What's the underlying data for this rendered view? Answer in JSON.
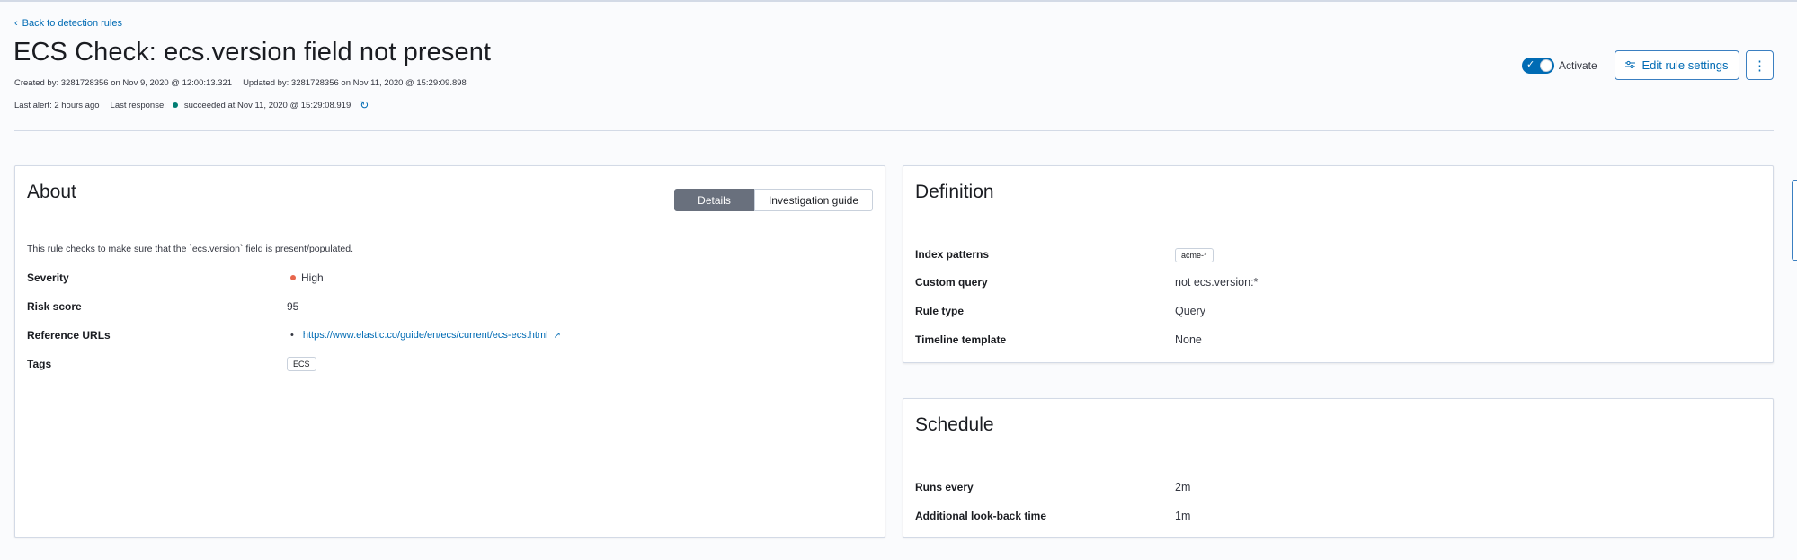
{
  "nav": {
    "back_label": "Back to detection rules"
  },
  "rule": {
    "title": "ECS Check: ecs.version field not present",
    "created": "Created by: 3281728356 on Nov 9, 2020 @ 12:00:13.321",
    "updated": "Updated by: 3281728356 on Nov 11, 2020 @ 15:29:09.898",
    "last_alert": "Last alert: 2 hours ago",
    "last_response_label": "Last response:",
    "last_response_value": "succeeded at Nov 11, 2020 @ 15:29:08.919"
  },
  "actions": {
    "activate_label": "Activate",
    "activate_on": true,
    "edit_label": "Edit rule settings"
  },
  "about": {
    "title": "About",
    "tabs": [
      "Details",
      "Investigation guide"
    ],
    "active_tab": "Details",
    "description": "This rule checks to make sure that the `ecs.version` field is present/populated.",
    "fields": {
      "severity_label": "Severity",
      "severity_value": "High",
      "risk_label": "Risk score",
      "risk_value": "95",
      "refs_label": "Reference URLs",
      "refs_value": "https://www.elastic.co/guide/en/ecs/current/ecs-ecs.html",
      "tags_label": "Tags",
      "tags_value": "ECS"
    }
  },
  "definition": {
    "title": "Definition",
    "index_label": "Index patterns",
    "index_value": "acme-*",
    "query_label": "Custom query",
    "query_value": "not ecs.version:*",
    "type_label": "Rule type",
    "type_value": "Query",
    "timeline_label": "Timeline template",
    "timeline_value": "None"
  },
  "schedule": {
    "title": "Schedule",
    "runs_label": "Runs every",
    "runs_value": "2m",
    "lookback_label": "Additional look-back time",
    "lookback_value": "1m"
  },
  "colors": {
    "accent": "#006bb4",
    "success": "#017d73",
    "severity_high": "#e7664c"
  }
}
